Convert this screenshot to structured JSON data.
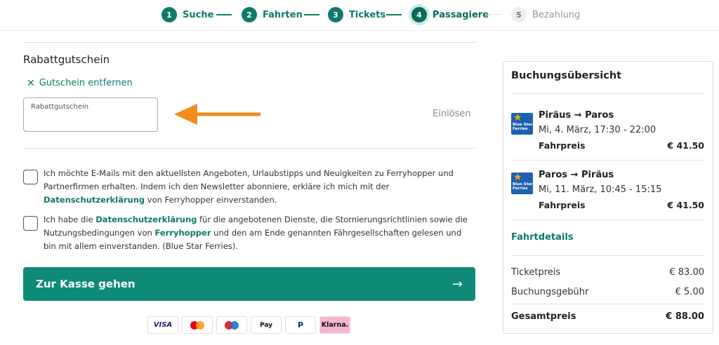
{
  "stepper": {
    "steps": [
      {
        "num": "1",
        "label": "Suche"
      },
      {
        "num": "2",
        "label": "Fahrten"
      },
      {
        "num": "3",
        "label": "Tickets"
      },
      {
        "num": "4",
        "label": "Passagiere"
      },
      {
        "num": "5",
        "label": "Bezahlung"
      }
    ]
  },
  "voucher": {
    "title": "Rabattgutschein",
    "remove_label": "Gutschein entfernen",
    "input_placeholder": "Rabattgutschein",
    "redeem_label": "Einlösen"
  },
  "consent": {
    "newsletter": {
      "part1": "Ich möchte E-Mails mit den aktuellsten Angeboten, Urlaubstipps und Neuigkeiten zu Ferryhopper und Partnerfirmen erhalten. Indem ich den Newsletter abonniere, erkläre ich mich mit der ",
      "link": "Datenschutzerklärung",
      "part2": " von Ferryhopper einverstanden."
    },
    "terms": {
      "part1": "Ich habe die ",
      "link1": "Datenschutzerklärung",
      "part2": " für die angebotenen Dienste, die Stornierungsrichtlinien sowie die Nutzungsbedingungen von ",
      "link2": "Ferryhopper",
      "part3": " und den am Ende genannten Fährgesellschaften gelesen und bin mit allem einverstanden. (Blue Star Ferries)."
    }
  },
  "checkout": {
    "label": "Zur Kasse gehen",
    "arrow": "→"
  },
  "payments": {
    "visa": "VISA",
    "applepay": " Pay",
    "paypal": "P",
    "klarna": "Klarna."
  },
  "summary": {
    "title": "Buchungsübersicht",
    "operator_logo": "Blue Star Ferries",
    "trips": [
      {
        "route": "Piräus → Paros",
        "time": "Mi, 4. März, 17:30 - 22:00",
        "fare_label": "Fahrpreis",
        "fare": "€ 41.50"
      },
      {
        "route": "Paros → Piräus",
        "time": "Mi, 11. März, 10:45 - 15:15",
        "fare_label": "Fahrpreis",
        "fare": "€ 41.50"
      }
    ],
    "details_link": "Fahrtdetails",
    "ticket_price_label": "Ticketpreis",
    "ticket_price": "€ 83.00",
    "booking_fee_label": "Buchungsgebühr",
    "booking_fee": "€ 5.00",
    "total_label": "Gesamtpreis",
    "total": "€ 88.00"
  },
  "colors": {
    "accent": "#0e7a68",
    "cta": "#0e8a76",
    "annotation_arrow": "#f28c1c"
  }
}
